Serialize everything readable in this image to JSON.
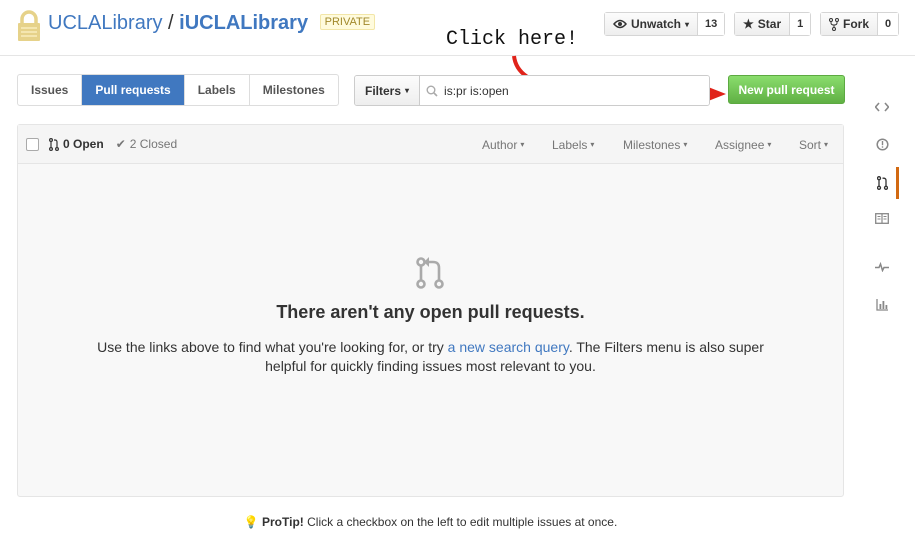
{
  "repo": {
    "owner": "UCLALibrary",
    "separator": "/",
    "name": "iUCLALibrary",
    "visibility": "PRIVATE"
  },
  "header_actions": {
    "watch_label": "Unwatch",
    "watch_count": "13",
    "star_label": "Star",
    "star_count": "1",
    "fork_label": "Fork",
    "fork_count": "0"
  },
  "annotation": {
    "text": "Click here!",
    "arrow_color": "#e0231a"
  },
  "nav_tabs": [
    "Issues",
    "Pull requests",
    "Labels",
    "Milestones"
  ],
  "filters": {
    "button_label": "Filters",
    "query": "is:pr is:open"
  },
  "new_pr_label": "New pull request",
  "list_header": {
    "open_label": "0 Open",
    "closed_label": "2 Closed",
    "selectors": [
      "Author",
      "Labels",
      "Milestones",
      "Assignee",
      "Sort"
    ]
  },
  "blankslate": {
    "title": "There aren't any open pull requests.",
    "text_before": "Use the links above to find what you're looking for, or try ",
    "link_text": "a new search query",
    "text_after": ". The Filters menu is also super helpful for quickly finding issues most relevant to you."
  },
  "protip": {
    "label": "ProTip!",
    "text": " Click a checkbox on the left to edit multiple issues at once."
  },
  "colors": {
    "link": "#4078c0",
    "active_tab": "#4078c0",
    "new_pr_green": "#6cc644",
    "rail_active": "#d26911"
  }
}
